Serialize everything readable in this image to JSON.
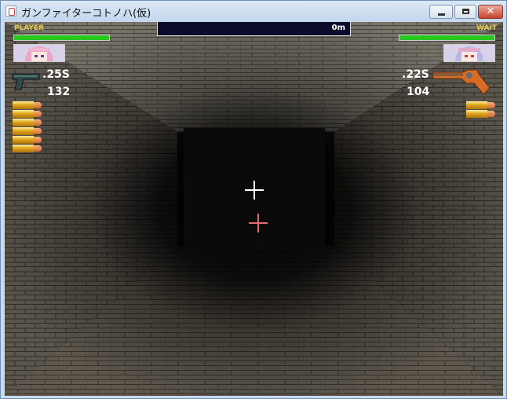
{
  "window": {
    "title": "ガンファイターコトノハ(仮)"
  },
  "hud": {
    "player_label": "PLAYER",
    "enemy_label": "WAIT",
    "distance": "0m",
    "player": {
      "ammo_type": ".25S",
      "ammo_count": "132",
      "hp_fraction": 1.0,
      "loaded_rounds": 6,
      "gun_icon": "pistol-icon"
    },
    "enemy": {
      "ammo_type": ".22S",
      "ammo_count": "104",
      "hp_fraction": 1.0,
      "loaded_rounds": 2,
      "gun_icon": "revolver-icon"
    }
  },
  "colors": {
    "hp": "#27c81f",
    "label": "#e8c850",
    "crosshair_player": "#ffffff",
    "crosshair_enemy": "#e07070"
  }
}
